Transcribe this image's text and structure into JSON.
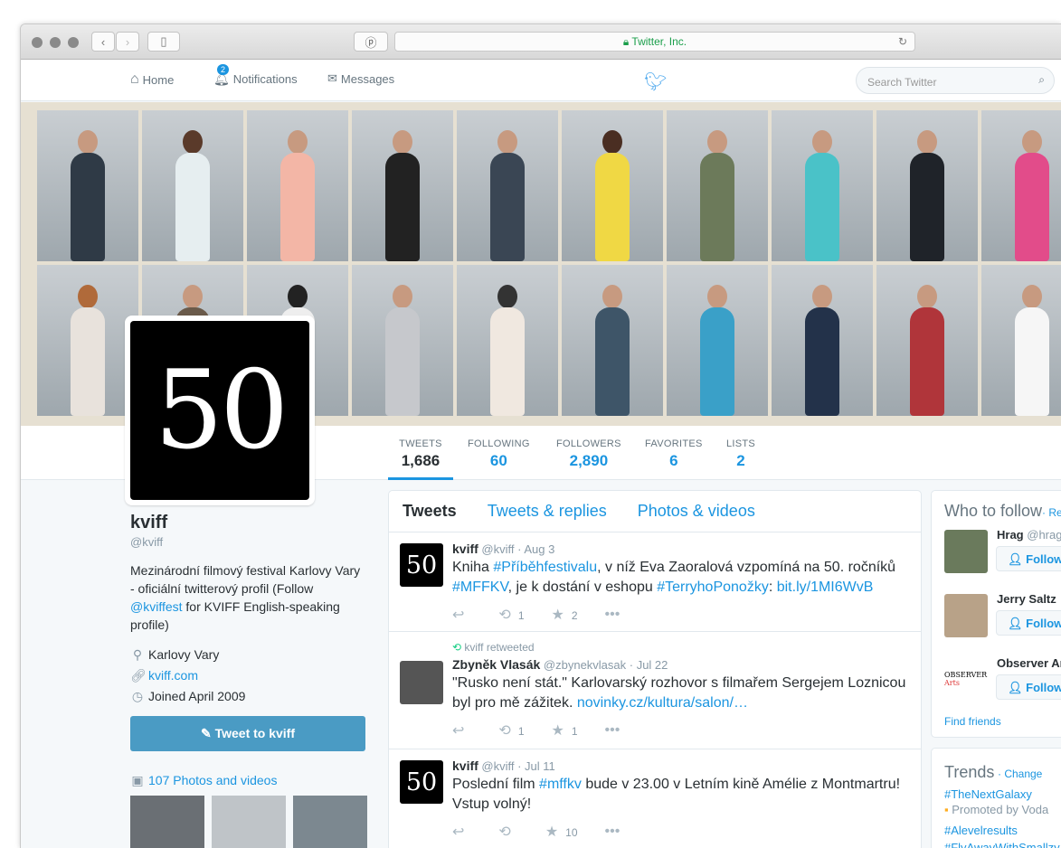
{
  "browser": {
    "url": "Twitter, Inc."
  },
  "nav": {
    "home": "Home",
    "notifications": "Notifications",
    "notif_badge": "2",
    "messages": "Messages",
    "search_placeholder": "Search Twitter"
  },
  "profile": {
    "avatar_text": "50",
    "name": "kviff",
    "handle": "@kviff",
    "bio_pre": "Mezinárodní filmový festival Karlovy Vary - oficiální twitterový profil (Follow ",
    "bio_link": "@kviffest",
    "bio_post": " for KVIFF English-speaking profile)",
    "location": "Karlovy Vary",
    "website": "kviff.com",
    "joined": "Joined April 2009",
    "tweet_button": "Tweet to kviff",
    "photos_label": "107 Photos and videos"
  },
  "stats": [
    {
      "label": "TWEETS",
      "value": "1,686"
    },
    {
      "label": "FOLLOWING",
      "value": "60"
    },
    {
      "label": "FOLLOWERS",
      "value": "2,890"
    },
    {
      "label": "FAVORITES",
      "value": "6"
    },
    {
      "label": "LISTS",
      "value": "2"
    }
  ],
  "tabs": [
    "Tweets",
    "Tweets & replies",
    "Photos & videos"
  ],
  "tweets": [
    {
      "context": "",
      "name": "kviff",
      "meta": "@kviff · Aug 3",
      "text_a": "Kniha ",
      "tag1": "#Příběhfestivalu",
      "text_b": ", v níž Eva Zaoralová vzpomíná na 50. ročníků ",
      "tag2": "#MFFKV",
      "text_c": ", je k dostání v eshopu ",
      "tag3": "#TerryhoPonožky",
      "text_d": ": ",
      "link": "bit.ly/1MI6WvB",
      "retweets": "1",
      "favorites": "2"
    },
    {
      "context": "kviff retweeted",
      "name": "Zbyněk Vlasák",
      "meta": "@zbynekvlasak · Jul 22",
      "text_a": "\"Rusko není stát.\" Karlovarský rozhovor s filmařem Sergejem Loznicou byl pro mě zážitek. ",
      "link": "novinky.cz/kultura/salon/…",
      "retweets": "1",
      "favorites": "1"
    },
    {
      "context": "",
      "name": "kviff",
      "meta": "@kviff · Jul 11",
      "text_a": "Poslední film ",
      "tag1": "#mffkv",
      "text_b": " bude v 23.00 v Letním kině Amélie z Montmartru! Vstup volný!",
      "retweets": "",
      "favorites": "10"
    }
  ],
  "who_to_follow": {
    "title": "Who to follow",
    "refresh": "· Re",
    "users": [
      {
        "name": "Hrag",
        "handle": "@hrag"
      },
      {
        "name": "Jerry Saltz",
        "handle": ""
      },
      {
        "name": "Observer Ar",
        "handle": "",
        "avatar_text": "OBSERVER",
        "avatar_sub": "Arts"
      }
    ],
    "follow_label": "Follow",
    "find_friends": "Find friends"
  },
  "trends": {
    "title": "Trends",
    "change": "· Change",
    "items": [
      "#TheNextGalaxy",
      "#Alevelresults",
      "#FlyAwayWithSmallzy"
    ],
    "promoted": "Promoted by Voda"
  }
}
